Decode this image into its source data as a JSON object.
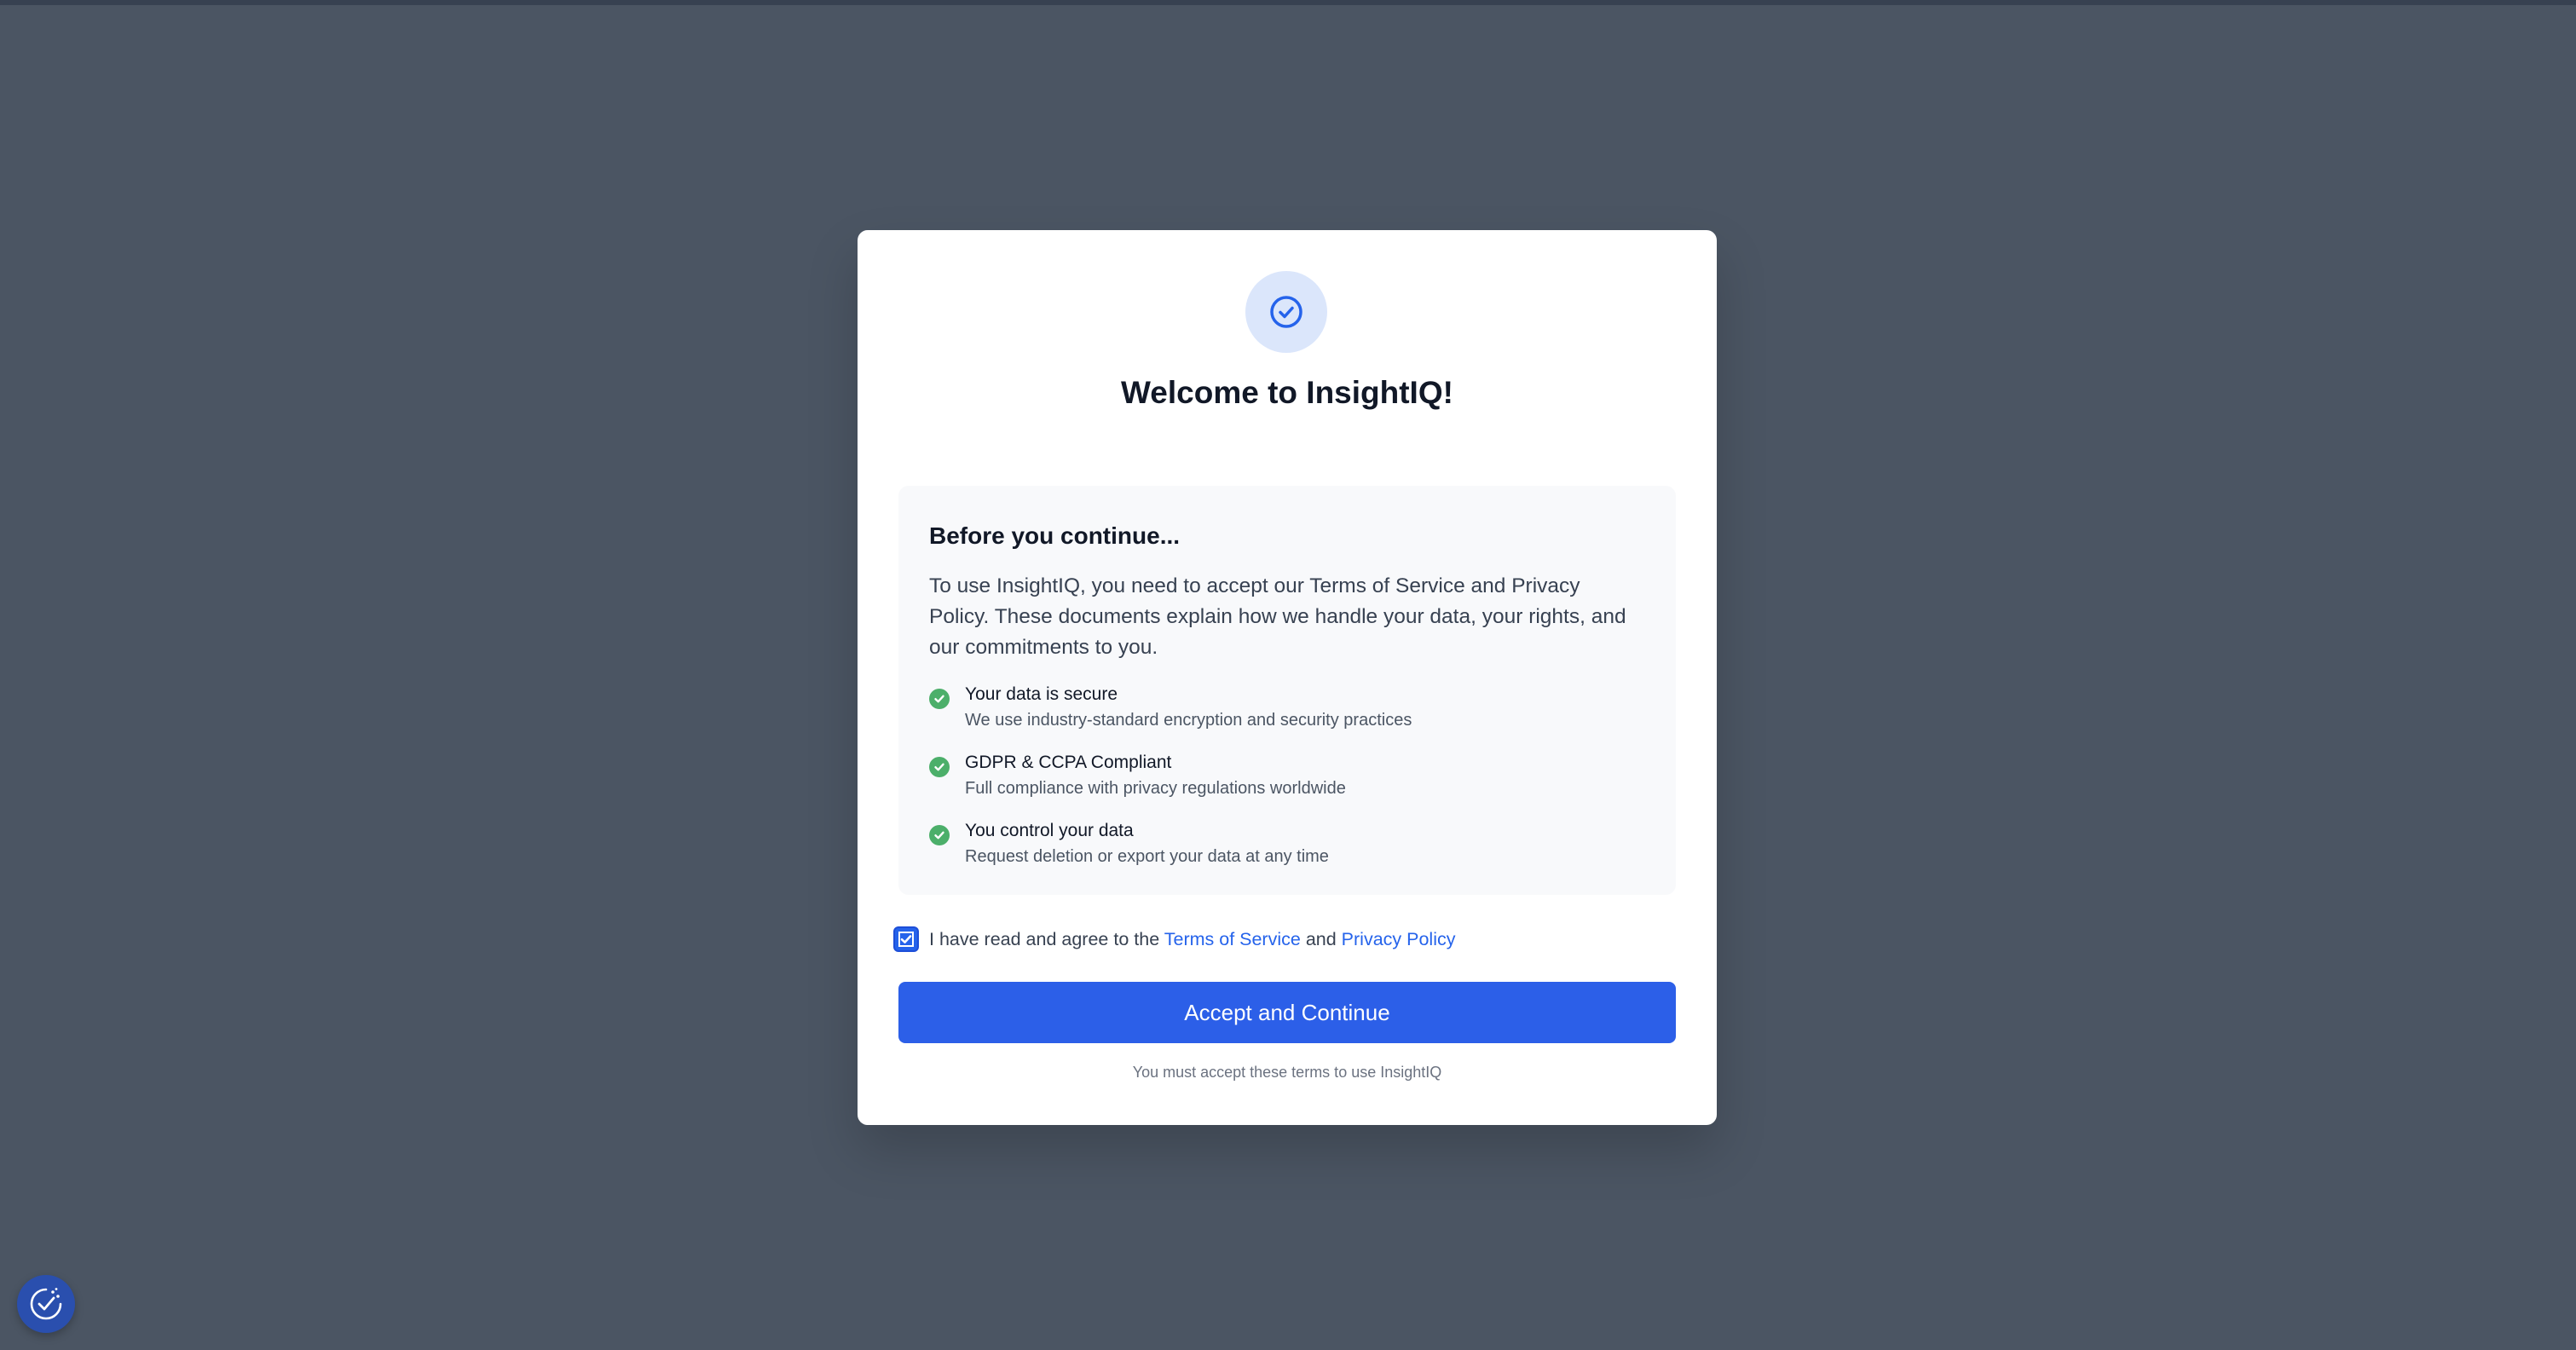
{
  "modal": {
    "title": "Welcome to InsightIQ!",
    "info": {
      "heading": "Before you continue...",
      "text": "To use InsightIQ, you need to accept our Terms of Service and Privacy Policy. These documents explain how we handle your data, your rights, and our commitments to you.",
      "features": [
        {
          "title": "Your data is secure",
          "desc": "We use industry-standard encryption and security practices"
        },
        {
          "title": "GDPR & CCPA Compliant",
          "desc": "Full compliance with privacy regulations worldwide"
        },
        {
          "title": "You control your data",
          "desc": "Request deletion or export your data at any time"
        }
      ]
    },
    "agree": {
      "checked": true,
      "prefix": "I have read and agree to the ",
      "terms_link": "Terms of Service",
      "middle": " and ",
      "privacy_link": "Privacy Policy"
    },
    "accept_button": "Accept and Continue",
    "footnote": "You must accept these terms to use InsightIQ"
  },
  "colors": {
    "backdrop": "#4b5563",
    "accent": "#2563eb",
    "success": "#4caf6a"
  },
  "icons": {
    "hero": "check-circle-icon",
    "feature": "check-icon",
    "fab": "cookie-consent-icon"
  }
}
